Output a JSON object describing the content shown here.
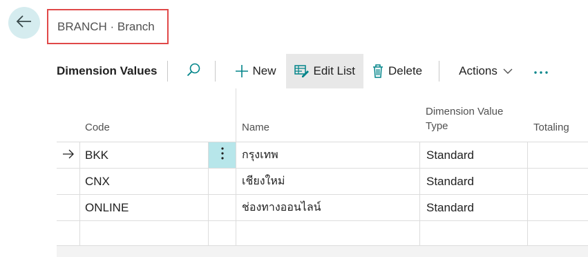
{
  "header": {
    "back_icon": "arrow-left-icon",
    "title": "BRANCH · Branch",
    "highlight_color": "#e04848"
  },
  "toolbar": {
    "title": "Dimension Values",
    "new_label": "New",
    "edit_list_label": "Edit List",
    "delete_label": "Delete",
    "actions_label": "Actions",
    "accent_color": "#008489"
  },
  "grid": {
    "columns": {
      "code": "Code",
      "name": "Name",
      "type": "Dimension Value Type",
      "totaling": "Totaling"
    },
    "rows": [
      {
        "code": "BKK",
        "name": "กรุงเทพ",
        "type": "Standard",
        "totaling": ""
      },
      {
        "code": "CNX",
        "name": "เชียงใหม่",
        "type": "Standard",
        "totaling": ""
      },
      {
        "code": "ONLINE",
        "name": "ช่องทางออนไลน์",
        "type": "Standard",
        "totaling": ""
      }
    ]
  }
}
